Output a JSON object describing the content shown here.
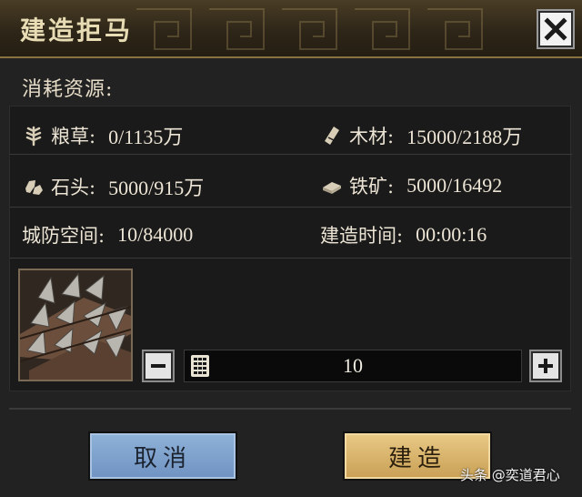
{
  "dialog": {
    "title": "建造拒马",
    "close_icon": "close-icon"
  },
  "cost_section": {
    "label": "消耗资源:"
  },
  "resources": {
    "grain": {
      "icon": "wheat-icon",
      "label": "粮草:",
      "value": "0/1135万"
    },
    "wood": {
      "icon": "wood-icon",
      "label": "木材:",
      "value": "15000/2188万"
    },
    "stone": {
      "icon": "stone-icon",
      "label": "石头:",
      "value": "5000/915万"
    },
    "iron": {
      "icon": "iron-ore-icon",
      "label": "铁矿:",
      "value": "5000/16492"
    },
    "defense_space": {
      "label": "城防空间:",
      "value": "10/84000"
    },
    "build_time": {
      "label": "建造时间:",
      "value": "00:00:16"
    }
  },
  "quantity": {
    "value": "10",
    "minus_icon": "minus-icon",
    "plus_icon": "plus-icon",
    "keypad_icon": "keypad-icon"
  },
  "buttons": {
    "cancel": "取消",
    "build": "建造"
  },
  "watermark": "头条 @奕道君心",
  "colors": {
    "title_bar": "#3a301f",
    "panel_bg": "#1a1a1a",
    "cancel_button": "#7fa2cd",
    "build_button": "#dbb871"
  }
}
